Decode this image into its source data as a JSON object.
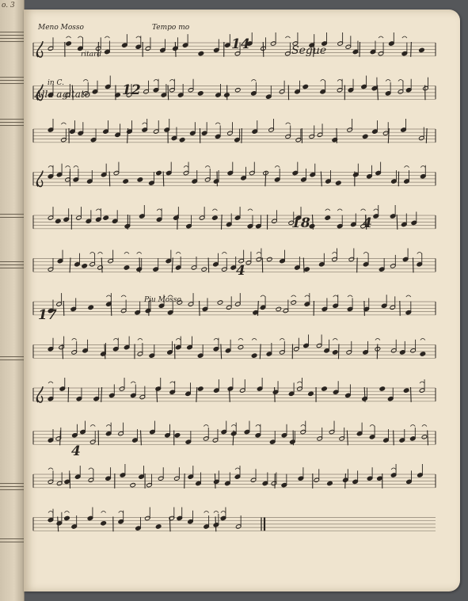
{
  "left_page": {
    "corner_mark": "o. 3"
  },
  "score": {
    "annotations": {
      "meno_mosso": "Meno Mosso",
      "ritard": "ritard",
      "tempo_mo": "Tempo mo",
      "rest_14": "14",
      "segue": "Segue",
      "in_c": "in C.",
      "alla_agitato": "Alla agitato",
      "rest_12": "12",
      "rest_18": "18",
      "rest_4a": "4",
      "rest_4b": "4",
      "rest_17": "17",
      "rest_4c": "4",
      "piu_mosso": "Piu Mosso"
    },
    "staff_count": 12
  }
}
